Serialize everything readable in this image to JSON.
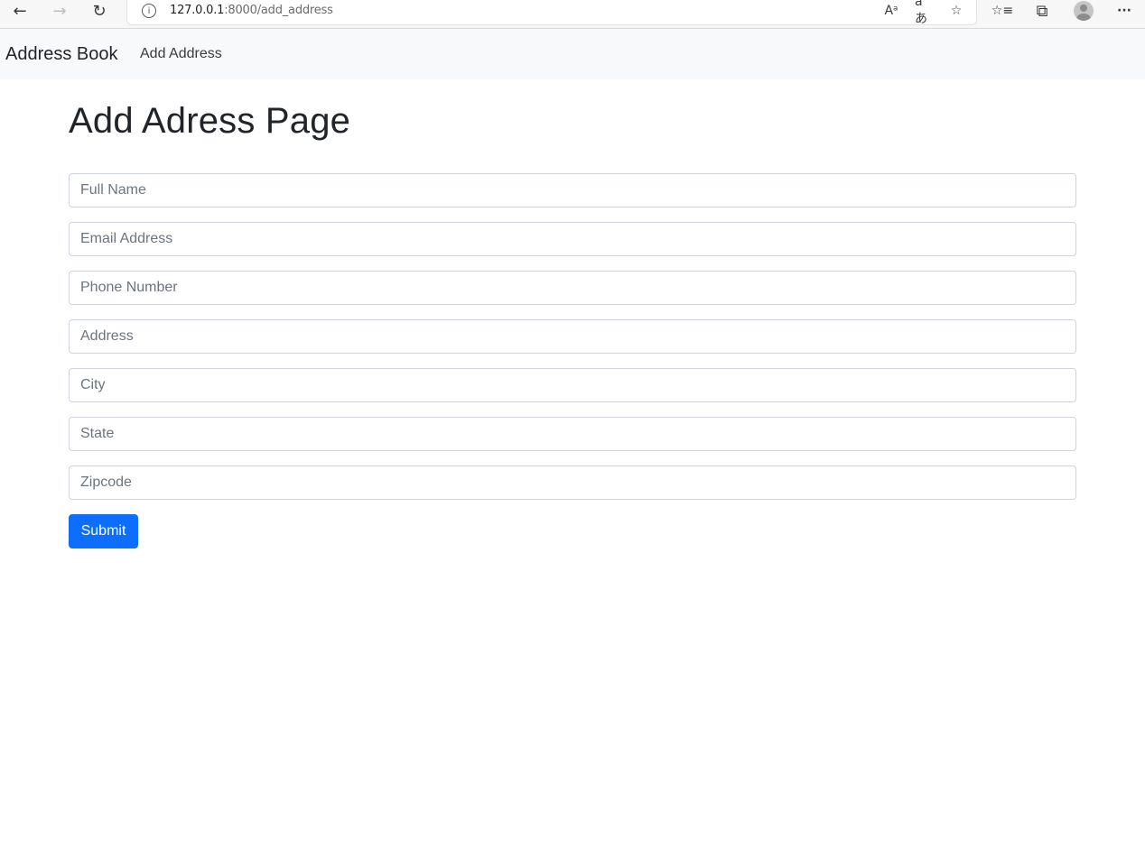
{
  "browser": {
    "back_icon": "←",
    "forward_icon": "→",
    "reload_icon": "↻",
    "info_icon": "i",
    "url_host": "127.0.0.1",
    "url_path": ":8000/add_address",
    "read_aloud_icon": "Aᵃ",
    "translate_icon": "aあ",
    "favorite_add_icon": "☆",
    "favorites_icon": "☆≡",
    "collections_icon": "⧉",
    "more_icon": "···"
  },
  "navbar": {
    "brand": "Address Book",
    "links": [
      {
        "label": "Add Address"
      }
    ]
  },
  "main": {
    "title": "Add Adress Page",
    "fields": [
      {
        "placeholder": "Full Name",
        "value": ""
      },
      {
        "placeholder": "Email Address",
        "value": ""
      },
      {
        "placeholder": "Phone Number",
        "value": ""
      },
      {
        "placeholder": "Address",
        "value": ""
      },
      {
        "placeholder": "City",
        "value": ""
      },
      {
        "placeholder": "State",
        "value": ""
      },
      {
        "placeholder": "Zipcode",
        "value": ""
      }
    ],
    "submit_label": "Submit"
  },
  "colors": {
    "primary": "#0d6efd",
    "navbar_bg": "#f8f9fa",
    "input_border": "#ced4da",
    "placeholder": "#6c757d"
  }
}
